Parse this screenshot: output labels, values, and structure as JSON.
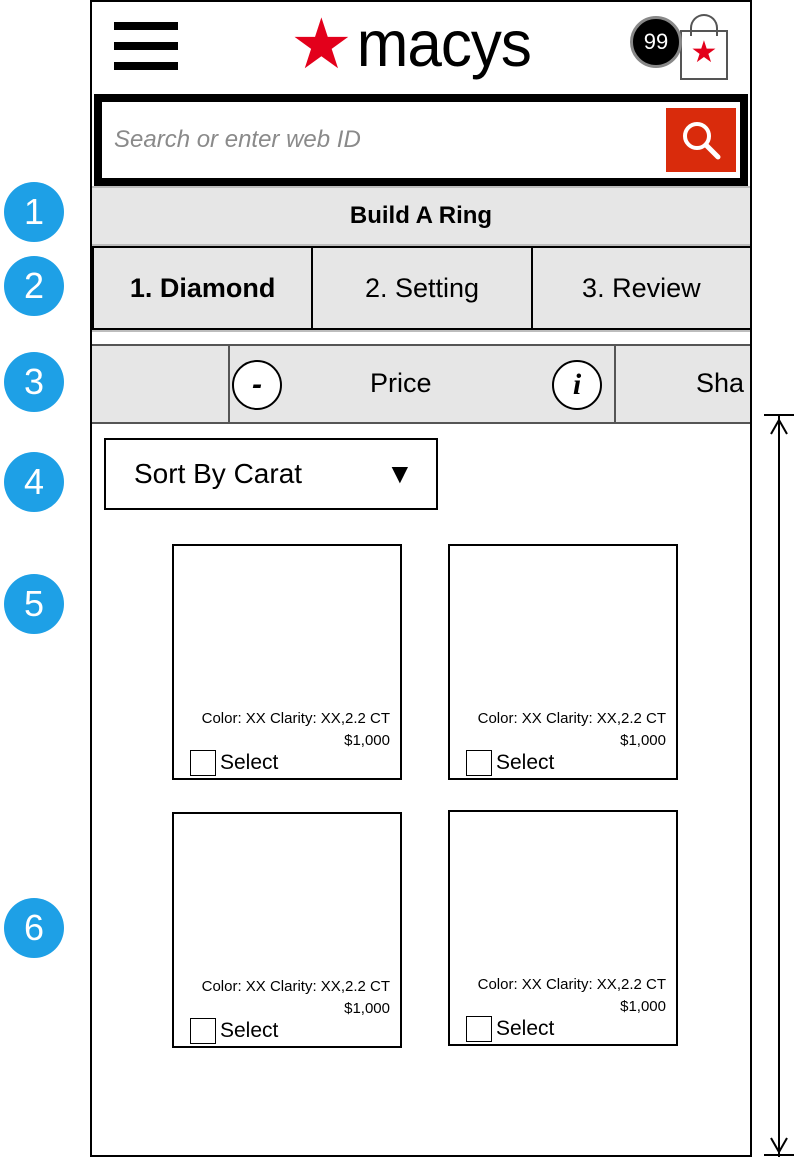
{
  "annotations": [
    "1",
    "2",
    "3",
    "4",
    "5",
    "6"
  ],
  "header": {
    "logo_text": "macys",
    "cart_count": "99"
  },
  "search": {
    "placeholder": "Search or enter web ID"
  },
  "build_bar": {
    "title": "Build A Ring"
  },
  "steps": [
    {
      "label": "1. Diamond",
      "active": true
    },
    {
      "label": "2. Setting",
      "active": false
    },
    {
      "label": "3. Review",
      "active": false
    }
  ],
  "filters": {
    "minus_label": "-",
    "price_label": "Price",
    "info_label": "i",
    "next_label": "Sha"
  },
  "sort": {
    "label": "Sort By Carat",
    "arrow": "▼"
  },
  "products": [
    {
      "info": "Color: XX Clarity: XX,2.2 CT",
      "price": "$1,000",
      "select_label": "Select"
    },
    {
      "info": "Color: XX Clarity: XX,2.2 CT",
      "price": "$1,000",
      "select_label": "Select"
    },
    {
      "info": "Color: XX Clarity: XX,2.2 CT",
      "price": "$1,000",
      "select_label": "Select"
    },
    {
      "info": "Color: XX Clarity: XX,2.2 CT",
      "price": "$1,000",
      "select_label": "Select"
    }
  ],
  "colors": {
    "annotation": "#1ea0e6",
    "brand_red": "#e3001b",
    "search_button": "#d92b0c",
    "bar_gray": "#e6e6e6"
  },
  "icons": {
    "menu": "hamburger-menu-icon",
    "logo_star": "star-icon",
    "bag": "shopping-bag-icon",
    "search": "search-icon",
    "dropdown": "triangle-down-icon"
  }
}
